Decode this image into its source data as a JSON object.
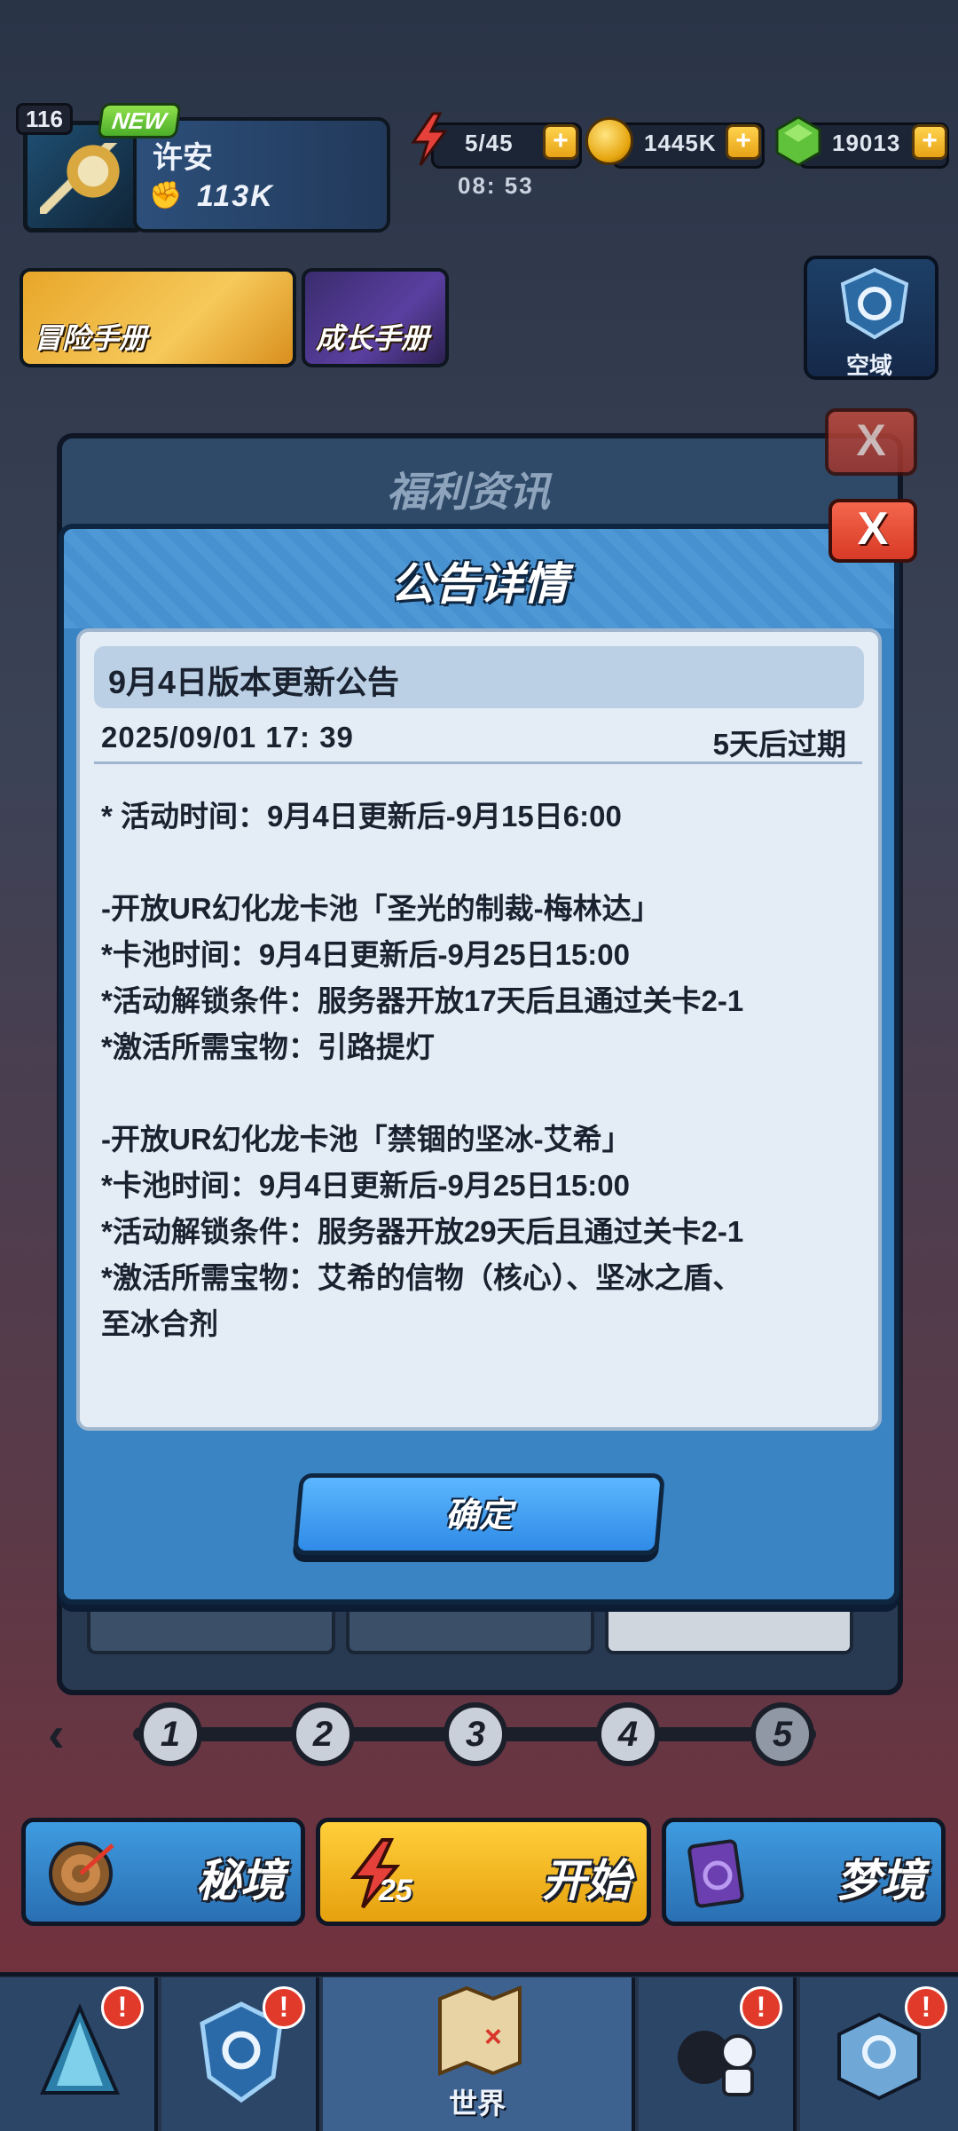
{
  "hud": {
    "level": "116",
    "new_badge": "NEW",
    "player_name": "许安",
    "power": "113K",
    "energy": "5/45",
    "energy_timer": "08: 53",
    "coins": "1445K",
    "gems": "19013",
    "plus": "+"
  },
  "side_buttons": {
    "adventure_book": "冒险手册",
    "growth_book": "成长手册",
    "airspace": "空域"
  },
  "background_panel": {
    "title": "福利资讯",
    "close_glyph": "X"
  },
  "dialog": {
    "title": "公告详情",
    "close_glyph": "X",
    "notice_title": "9月4日版本更新公告",
    "date": "2025/09/01 17: 39",
    "expire": "5天后过期",
    "lines": [
      "* 活动时间：9月4日更新后-9月15日6:00",
      "",
      "-开放UR幻化龙卡池「圣光的制裁-梅林达」",
      "*卡池时间：9月4日更新后-9月25日15:00",
      "*活动解锁条件：服务器开放17天后且通过关卡2-1",
      "*激活所需宝物：引路提灯",
      "",
      "-开放UR幻化龙卡池「禁锢的坚冰-艾希」",
      "*卡池时间：9月4日更新后-9月25日15:00",
      "*活动解锁条件：服务器开放29天后且通过关卡2-1",
      "*激活所需宝物：艾希的信物（核心）、坚冰之盾、",
      "至冰合剂"
    ],
    "confirm": "确定"
  },
  "stages": [
    "1",
    "2",
    "3",
    "4",
    "5"
  ],
  "stage_prev_glyph": "‹",
  "actions": {
    "secret": "秘境",
    "start": "开始",
    "start_cost": "25",
    "dream": "梦境"
  },
  "nav": {
    "world": "世界",
    "alert": "!"
  },
  "colors": {
    "dialog_blue": "#3a84c4",
    "confirm_blue": "#2f8be6",
    "close_red": "#d83a26",
    "start_yellow": "#ffcf3a",
    "alert_red": "#e23a2a"
  },
  "icons": [
    "energy-icon",
    "coin-icon",
    "gem-icon",
    "close-icon",
    "target-icon",
    "card-icon",
    "map-icon",
    "shield-icon"
  ]
}
